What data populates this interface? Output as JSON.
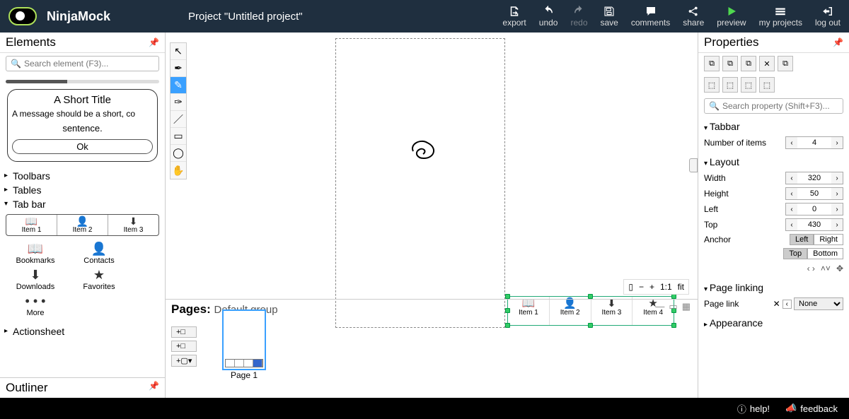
{
  "brand": "NinjaMock",
  "project_title": "Project \"Untitled project\"",
  "top_actions": [
    {
      "id": "export",
      "label": "export"
    },
    {
      "id": "undo",
      "label": "undo"
    },
    {
      "id": "redo",
      "label": "redo"
    },
    {
      "id": "save",
      "label": "save"
    },
    {
      "id": "comments",
      "label": "comments"
    },
    {
      "id": "share",
      "label": "share"
    },
    {
      "id": "preview",
      "label": "preview"
    },
    {
      "id": "my-projects",
      "label": "my projects"
    },
    {
      "id": "log-out",
      "label": "log out"
    }
  ],
  "elements_panel": {
    "title": "Elements",
    "search_placeholder": "Search element (F3)...",
    "alert_preview": {
      "title": "A Short Title",
      "message": "A message should be a short, co",
      "sentence": "sentence.",
      "ok": "Ok"
    },
    "groups": {
      "toolbars": "Toolbars",
      "tables": "Tables",
      "tabbar": "Tab bar",
      "actionsheet": "Actionsheet"
    },
    "tabbar_row": [
      {
        "icon": "📖",
        "label": "Item 1"
      },
      {
        "icon": "👤",
        "label": "Item 2"
      },
      {
        "icon": "⬇",
        "label": "Item 3"
      }
    ],
    "tabbar_cells": [
      {
        "icon": "📖",
        "label": "Bookmarks"
      },
      {
        "icon": "👤",
        "label": "Contacts"
      },
      {
        "icon": "⬇",
        "label": "Downloads"
      },
      {
        "icon": "★",
        "label": "Favorites"
      },
      {
        "icon": "• • •",
        "label": "More"
      }
    ]
  },
  "outliner_title": "Outliner",
  "tools": [
    "pointer",
    "pen",
    "pencil",
    "vector",
    "line",
    "rect",
    "ellipse",
    "hand"
  ],
  "canvas_tabbar": [
    {
      "icon": "📖",
      "label": "Item 1"
    },
    {
      "icon": "👤",
      "label": "Item 2"
    },
    {
      "icon": "⬇",
      "label": "Item 3"
    },
    {
      "icon": "★",
      "label": "Item 4"
    }
  ],
  "zoom": {
    "one": "1:1",
    "fit": "fit"
  },
  "pages": {
    "label": "Pages:",
    "group": "Default group",
    "actions": [
      "+□",
      "+□",
      "+▢▾"
    ],
    "page1": "Page 1"
  },
  "properties": {
    "title": "Properties",
    "search_placeholder": "Search property (Shift+F3)...",
    "sections": {
      "tabbar": "Tabbar",
      "layout": "Layout",
      "page_linking": "Page linking",
      "appearance": "Appearance"
    },
    "tabbar_section": {
      "num_items_label": "Number of items",
      "num_items": "4"
    },
    "layout": {
      "width_label": "Width",
      "width": "320",
      "height_label": "Height",
      "height": "50",
      "left_label": "Left",
      "left": "0",
      "top_label": "Top",
      "top": "430",
      "anchor_label": "Anchor",
      "anchor_h": [
        "Left",
        "Right"
      ],
      "anchor_v": [
        "Top",
        "Bottom"
      ]
    },
    "page_link": {
      "label": "Page link",
      "value": "None"
    }
  },
  "footer": {
    "help": "help!",
    "feedback": "feedback"
  }
}
